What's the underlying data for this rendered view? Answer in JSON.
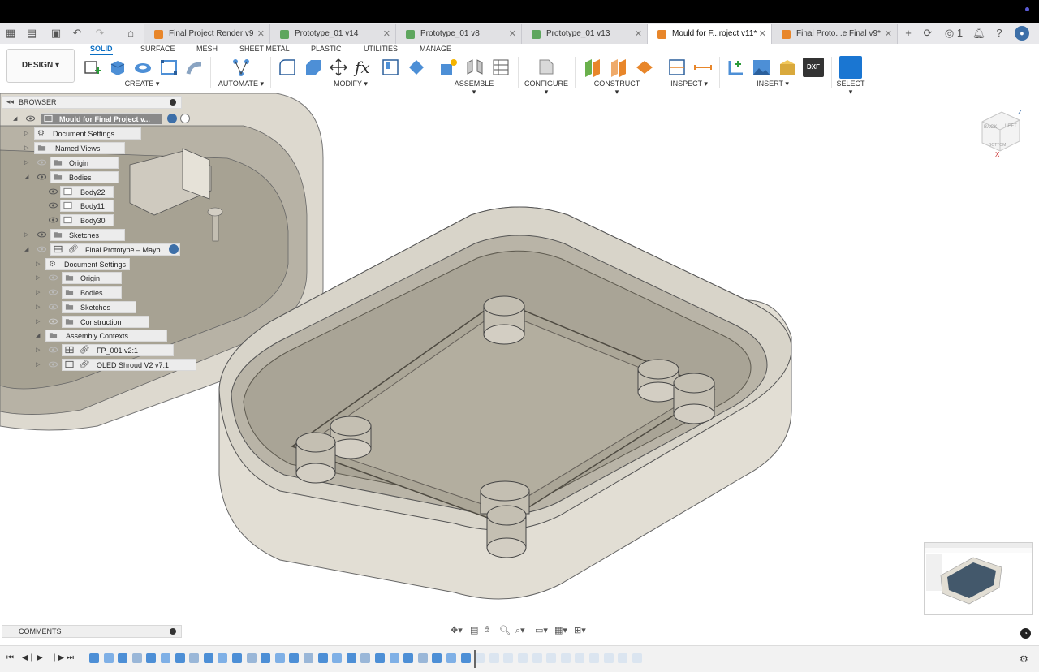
{
  "window": {
    "active_document": "Mould for Final Project v11"
  },
  "tabs": [
    {
      "label": "Final Project Render v9",
      "color": "#e8862a",
      "active": false
    },
    {
      "label": "Prototype_01 v14",
      "color": "#5ea65e",
      "active": false
    },
    {
      "label": "Prototype_01 v8",
      "color": "#5ea65e",
      "active": false
    },
    {
      "label": "Prototype_01 v13",
      "color": "#5ea65e",
      "active": false
    },
    {
      "label": "Mould for F...roject v11*",
      "color": "#e8862a",
      "active": true
    },
    {
      "label": "Final Proto...e Final v9*",
      "color": "#e8862a",
      "active": false
    }
  ],
  "topbar": {
    "job_count": "1"
  },
  "ribbon": {
    "workspace": "DESIGN ▾",
    "tabs": [
      "SOLID",
      "SURFACE",
      "MESH",
      "SHEET METAL",
      "PLASTIC",
      "UTILITIES",
      "MANAGE"
    ],
    "groups": [
      "CREATE ▾",
      "AUTOMATE ▾",
      "MODIFY ▾",
      "ASSEMBLE ▾",
      "CONFIGURE ▾",
      "CONSTRUCT ▾",
      "INSPECT ▾",
      "INSERT ▾",
      "SELECT ▾"
    ],
    "dxf_label": "DXF"
  },
  "browser": {
    "title": "BROWSER",
    "root": "Mould for Final Project v...",
    "items": [
      "Document Settings",
      "Named Views",
      "Origin",
      "Bodies",
      "Body22",
      "Body11",
      "Body30",
      "Sketches",
      "Final Prototype – Mayb...",
      "Document Settings",
      "Origin",
      "Bodies",
      "Sketches",
      "Construction",
      "Assembly Contexts",
      "FP_001 v2:1",
      "OLED Shroud V2 v7:1"
    ]
  },
  "comments": {
    "title": "COMMENTS"
  },
  "viewcube": {
    "top": "BACK",
    "left": "LEFT",
    "bottom": "BOTTOM",
    "axis_z": "Z",
    "axis_x": "X"
  },
  "colors": {
    "accent": "#0a6fc4",
    "model": "#d6d2c7",
    "model_shadow": "#a9a496"
  }
}
